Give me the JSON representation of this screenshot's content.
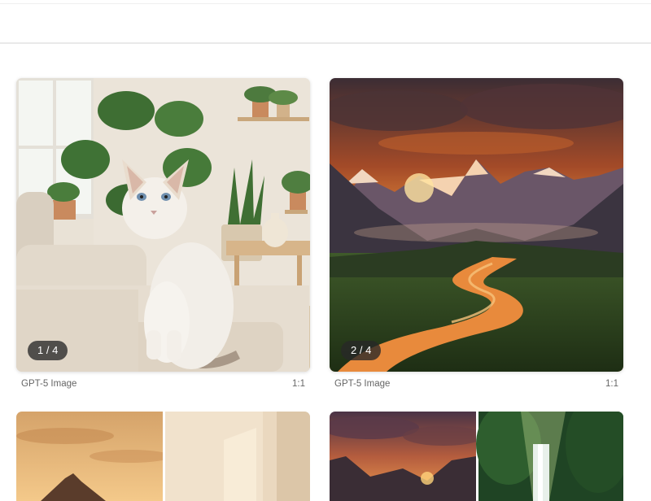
{
  "gallery": {
    "cards": [
      {
        "counter": "1 / 4",
        "model": "GPT-5 Image",
        "ratio": "1:1",
        "subject": "cat-living-room-image"
      },
      {
        "counter": "2 / 4",
        "model": "GPT-5 Image",
        "ratio": "1:1",
        "subject": "mountain-sunset-river-image"
      }
    ],
    "partial_cards": [
      {
        "subject": "desert-sunset-and-room-image"
      },
      {
        "subject": "mountain-sunset-and-waterfall-image"
      }
    ]
  }
}
